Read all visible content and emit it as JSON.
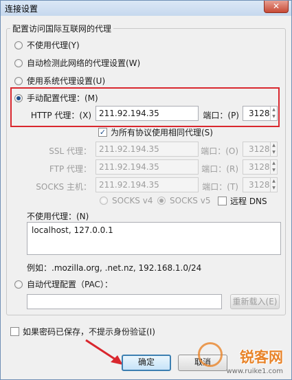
{
  "window": {
    "title": "连接设置",
    "close_glyph": "✕"
  },
  "group": {
    "title": "配置访问国际互联网的代理"
  },
  "options": {
    "no_proxy": "不使用代理(Y)",
    "auto_detect": "自动检测此网络的代理设置(W)",
    "system": "使用系统代理设置(U)",
    "manual": "手动配置代理：(M)"
  },
  "manual": {
    "http_label": "HTTP 代理：(X)",
    "http_value": "211.92.194.35",
    "port_label": "端口：(P)",
    "http_port": "3128",
    "same_proxy_label": "为所有协议使用相同代理(S)",
    "ssl_label": "SSL 代理：",
    "ssl_value": "211.92.194.35",
    "ssl_port_label": "端口：(O)",
    "ssl_port": "3128",
    "ftp_label": "FTP 代理：",
    "ftp_value": "211.92.194.35",
    "ftp_port_label": "端口：(R)",
    "ftp_port": "3128",
    "socks_label": "SOCKS 主机：",
    "socks_value": "211.92.194.35",
    "socks_port_label": "端口：(T)",
    "socks_port": "3128",
    "socks_v4": "SOCKS v4",
    "socks_v5": "SOCKS v5",
    "remote_dns": "远程 DNS"
  },
  "no_proxy_for": {
    "label": "不使用代理：(N)",
    "value": "localhost, 127.0.0.1",
    "example": "例如：.mozilla.org, .net.nz, 192.168.1.0/24"
  },
  "pac": {
    "label": "自动代理配置（PAC）：",
    "value": "",
    "reload": "重新载入(E)"
  },
  "no_prompt_auth": "如果密码已保存，不提示身份验证(I)",
  "buttons": {
    "ok": "确定",
    "cancel": "取消"
  },
  "watermark": {
    "brand": "锐客网",
    "domain": "www.ruike1.com"
  },
  "colors": {
    "highlight": "#d9272e",
    "accent": "#1f4f8c"
  }
}
